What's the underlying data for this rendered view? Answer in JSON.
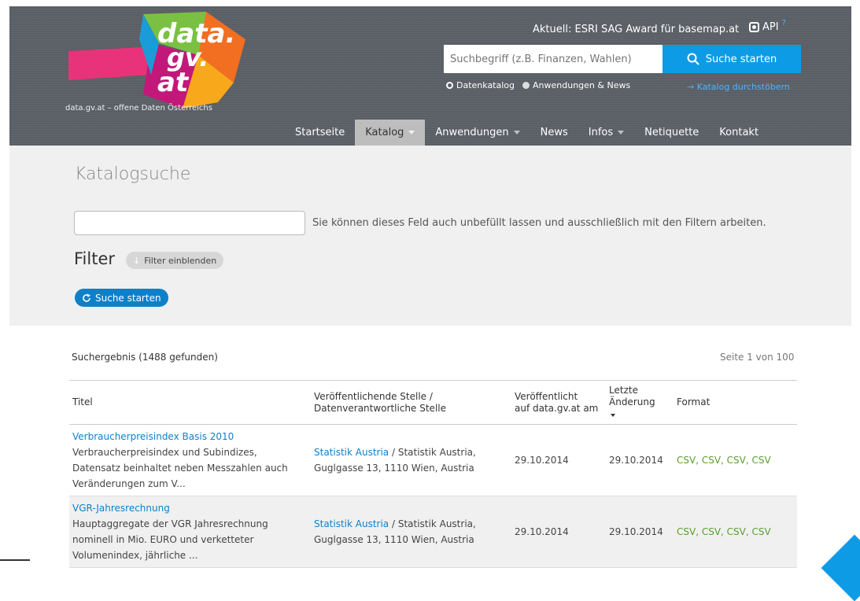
{
  "header": {
    "logo_text": [
      "data.",
      "gv.",
      "at"
    ],
    "tagline": "data.gv.at – offene Daten Österreichs",
    "news": "Aktuell: ESRI SAG Award für basemap.at",
    "api": "API",
    "search_placeholder": "Suchbegriff (z.B. Finanzen, Wahlen)",
    "search_button": "Suche starten",
    "radio_catalog": "Datenkatalog",
    "radio_apps": "Anwendungen & News",
    "browse": "→ Katalog durchstöbern",
    "nav": [
      "Startseite",
      "Katalog",
      "Anwendungen",
      "News",
      "Infos",
      "Netiquette",
      "Kontakt"
    ]
  },
  "search_panel": {
    "title": "Katalogsuche",
    "hint": "Sie können dieses Feld auch unbefüllt lassen und ausschließlich mit den Filtern arbeiten.",
    "filter_title": "Filter",
    "filter_button": "Filter einblenden",
    "search_button": "Suche starten"
  },
  "results": {
    "count": "Suchergebnis (1488 gefunden)",
    "page": "Seite 1 von 100",
    "columns": {
      "title": "Titel",
      "publisher_1": "Veröffentlichende Stelle /",
      "publisher_2": "Datenverantwortliche Stelle",
      "published_1": "Veröffentlicht",
      "published_2": "auf data.gv.at am",
      "changed_1": "Letzte",
      "changed_2": "Änderung",
      "format": "Format"
    },
    "rows": [
      {
        "title": "Verbraucherpreisindex Basis 2010",
        "desc": "Verbraucherpreisindex und Subindizes, Datensatz beinhaltet neben Messzahlen auch Veränderungen zum V...",
        "publisher": "Statistik Austria",
        "responsible": " / Statistik Austria, Guglgasse 13, 1110 Wien, Austria",
        "published": "29.10.2014",
        "changed": "29.10.2014",
        "format": "CSV, CSV, CSV, CSV"
      },
      {
        "title": "VGR-Jahresrechnung",
        "desc": "Hauptaggregate der VGR Jahresrechnung nominell in Mio. EURO und verketteter Volumenindex, jährliche ...",
        "publisher": "Statistik Austria",
        "responsible": " / Statistik Austria, Guglgasse 13, 1110 Wien, Austria",
        "published": "29.10.2014",
        "changed": "29.10.2014",
        "format": "CSV, CSV, CSV, CSV"
      }
    ]
  },
  "colors": {
    "header_bg": "#5d6168",
    "accent_blue": "#0e9be6",
    "link_blue": "#0e80c9",
    "format_green": "#5a9e2c"
  }
}
